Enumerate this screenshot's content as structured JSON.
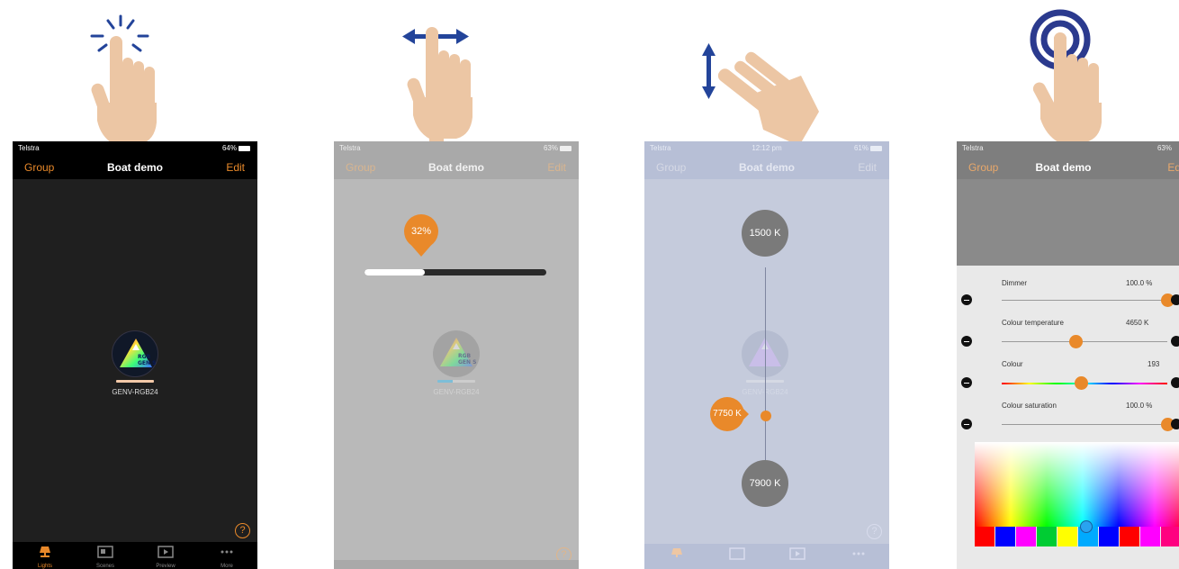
{
  "phones": [
    {
      "status": {
        "carrier": "Telstra",
        "time": "",
        "battery": "64%"
      },
      "nav": {
        "left": "Group",
        "title": "Boat demo",
        "right": "Edit"
      },
      "device": {
        "name": "GENV-RGB24",
        "logo_text": "RGB GEN S"
      },
      "help": "?",
      "tabs": [
        "Lights",
        "Scenes",
        "Preview",
        "More"
      ]
    },
    {
      "status": {
        "carrier": "Telstra",
        "time": "",
        "battery": "63%"
      },
      "nav": {
        "left": "Group",
        "title": "Boat demo",
        "right": "Edit"
      },
      "device": {
        "name": "GENV-RGB24",
        "logo_text": "RGB GEN S"
      },
      "dimmer_bubble": "32%",
      "dimmer_level": 0.33,
      "help": "?"
    },
    {
      "status": {
        "carrier": "Telstra",
        "time": "12:12 pm",
        "battery": "61%"
      },
      "nav": {
        "left": "Group",
        "title": "Boat demo",
        "right": "Edit"
      },
      "device": {
        "name": "GENV-RGB24",
        "logo_text": "RGB GEN S"
      },
      "temp_top": "1500 K",
      "temp_current": "7750 K",
      "temp_bottom": "7900 K",
      "help": "?"
    },
    {
      "status": {
        "carrier": "Telstra",
        "time": "",
        "battery": "63%"
      },
      "nav": {
        "left": "Group",
        "title": "Boat demo",
        "right": "Ed"
      },
      "sliders": [
        {
          "label": "Dimmer",
          "value": "100.0 %",
          "level": 1.0
        },
        {
          "label": "Colour temperature",
          "value": "4650 K",
          "level": 0.45
        },
        {
          "label": "Colour",
          "value": "193",
          "level": 0.48
        },
        {
          "label": "Colour saturation",
          "value": "100.0 %",
          "level": 1.0
        }
      ]
    }
  ],
  "colors": {
    "accent": "#e9892a",
    "arrow_blue": "#23449a",
    "skin": "#ecc6a4",
    "tap_ring": "#2b3a8e"
  },
  "swatches": [
    "#ff0000",
    "#0000ff",
    "#ff00ff",
    "#00cc33",
    "#ffff00",
    "#00aaff",
    "#0000ff",
    "#ff0000",
    "#ff00ff",
    "#ff0080",
    "#a0c8ff",
    "#ff0000"
  ]
}
